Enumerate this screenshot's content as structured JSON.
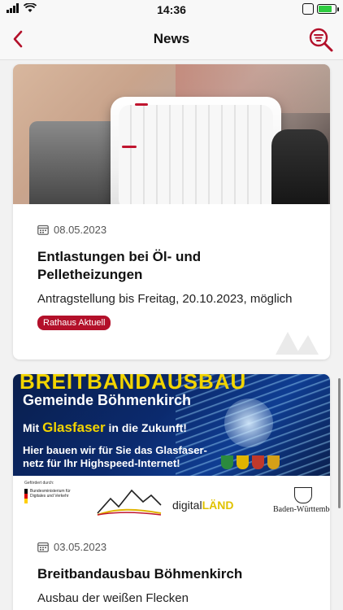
{
  "statusbar": {
    "time": "14:36"
  },
  "nav": {
    "title": "News",
    "back_icon": "chevron-left-icon",
    "search_icon": "search-filter-icon"
  },
  "colors": {
    "accent": "#b3102a",
    "background": "#f2f2f2"
  },
  "articles": [
    {
      "date": "08.05.2023",
      "title": "Entlastungen bei Öl- und Pelletheizungen",
      "subtitle": "Antragstellung bis Freitag, 20.10.2023, möglich",
      "tag": "Rathaus Aktuell",
      "image": "radiator-thermostat-photo"
    },
    {
      "date": "03.05.2023",
      "title": "Breitbandausbau Böhmenkirch",
      "subtitle": "Ausbau der weißen Flecken",
      "image": {
        "headline": "BREITBANDAUSBAU",
        "line1": "Gemeinde Böhmenkirch",
        "line2_pre": "Mit ",
        "line2_highlight": "Glasfaser",
        "line2_post": " in die Zukunft!",
        "line3": "Hier bauen wir für Sie das Glasfaser-netz für Ihr Highspeed-Internet!",
        "sponsor_funded": "Gefördert durch:",
        "sponsor_ministry": "Bundesministerium für Digitales und Verkehr",
        "sponsor_digital": "digital",
        "sponsor_land": "LÄND",
        "sponsor_state": "Baden-Württemberg"
      }
    }
  ]
}
